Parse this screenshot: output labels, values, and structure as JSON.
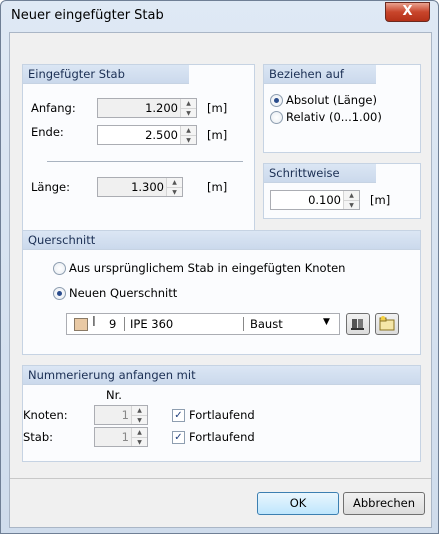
{
  "window": {
    "title": "Neuer eingefügter Stab",
    "close_glyph": "X"
  },
  "eingefuegter_stab": {
    "heading": "Eingefügter Stab",
    "anfang_label": "Anfang:",
    "anfang_value": "1.200",
    "anfang_unit": "[m]",
    "ende_label": "Ende:",
    "ende_value": "2.500",
    "ende_unit": "[m]",
    "laenge_label": "Länge:",
    "laenge_value": "1.300",
    "laenge_unit": "[m]"
  },
  "beziehen_auf": {
    "heading": "Beziehen auf",
    "options": [
      {
        "label": "Absolut (Länge)",
        "selected": true
      },
      {
        "label": "Relativ (0...1.00)",
        "selected": false
      }
    ]
  },
  "schrittweise": {
    "heading": "Schrittweise",
    "value": "0.100",
    "unit": "[m]"
  },
  "querschnitt": {
    "heading": "Querschnitt",
    "options": [
      {
        "label": "Aus ursprünglichem Stab in eingefügten Knoten",
        "selected": false
      },
      {
        "label": "Neuen Querschnitt",
        "selected": true
      }
    ],
    "section_number": "9",
    "section_name": "IPE 360",
    "material": "Baust",
    "swatch_color": "#e9c9a4"
  },
  "nummerierung": {
    "heading": "Nummerierung anfangen mit",
    "nr_header": "Nr.",
    "knoten_label": "Knoten:",
    "knoten_value": "1",
    "knoten_check": "Fortlaufend",
    "stab_label": "Stab:",
    "stab_value": "1",
    "stab_check": "Fortlaufend"
  },
  "buttons": {
    "ok": "OK",
    "cancel": "Abbrechen"
  }
}
